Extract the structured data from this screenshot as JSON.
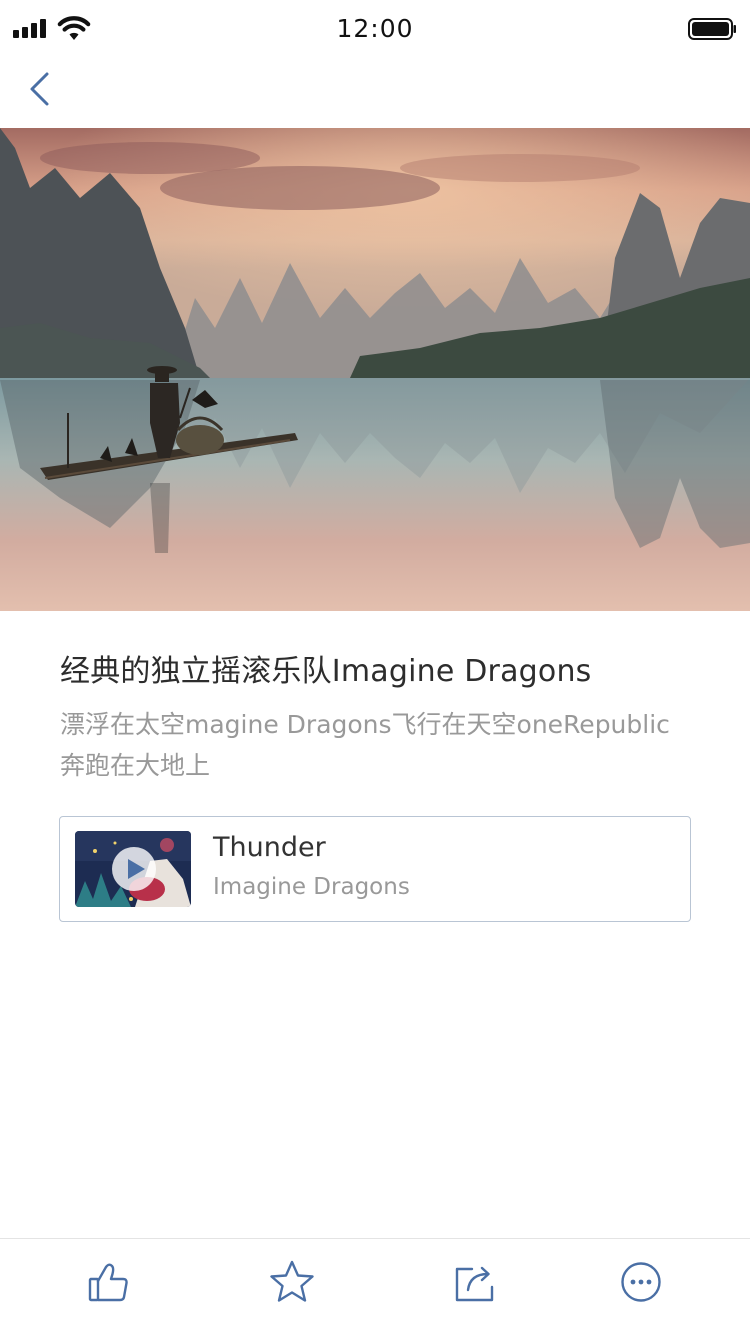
{
  "status_bar": {
    "time": "12:00",
    "icons": [
      "signal-icon",
      "wifi-icon",
      "battery-icon"
    ]
  },
  "nav": {
    "back_icon": "chevron-left-icon"
  },
  "hero": {
    "image": "karst-mountains-river-fisherman-photo"
  },
  "post": {
    "title": "经典的独立摇滚乐队Imagine Dragons",
    "description": "漂浮在太空magine Dragons飞行在天空oneRepublic奔跑在大地上"
  },
  "music": {
    "song": "Thunder",
    "artist": "Imagine Dragons",
    "icon": "play-icon"
  },
  "toolbar": {
    "items": [
      "thumbs-up-icon",
      "star-icon",
      "share-icon",
      "more-icon"
    ]
  },
  "colors": {
    "accent": "#4a6fa5",
    "title": "#2d2d2d",
    "secondary_text": "#999999",
    "card_border": "#b9c5d4"
  }
}
